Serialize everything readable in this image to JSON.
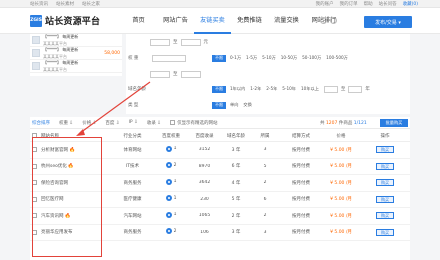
{
  "topbar": {
    "left": [
      "站长资讯",
      "站长素材",
      "站长之家"
    ],
    "right": [
      "我的账户",
      "我的订单",
      "帮助",
      "站长问答",
      "收藏(0)"
    ]
  },
  "logo": {
    "badge": "ZGIS",
    "text": "站长资源平台"
  },
  "nav": {
    "items": [
      "首页",
      "网站广告",
      "友链买卖",
      "免费推链",
      "流量交换",
      "网站排行"
    ],
    "active_index": 2
  },
  "publish_button": "发布/交易 ▾",
  "sidebar": {
    "items": [
      {
        "line1": "【*****】 每周更新",
        "line2": "某某某某平台",
        "price": ""
      },
      {
        "line1": "【*****】 每周更新",
        "line2": "某某某某平台",
        "price": "58,000"
      },
      {
        "line1": "【*****】 每周更新",
        "line2": "某某某某平台",
        "price": ""
      }
    ]
  },
  "filters": {
    "row1": {
      "unit_left": "至",
      "unit_right": "元"
    },
    "row2": {
      "label": "权 重",
      "btn": "不限",
      "options": [
        "0-1万",
        "1-5万",
        "5-10万",
        "10-50万",
        "50-100万",
        "100-500万"
      ]
    },
    "row3": {
      "unit": "至"
    },
    "row4": {
      "label": "域名年龄",
      "btn": "不限",
      "options": [
        "1年以内",
        "1-2年",
        "2-5年",
        "5-10年",
        "10年以上"
      ],
      "unit": "至",
      "unit2": "年"
    },
    "row5": {
      "label": "类 型",
      "btn": "不限",
      "options": [
        "单向",
        "交换"
      ]
    }
  },
  "tabs": {
    "items": [
      "综合排序",
      "权重 ⇩",
      "价格 ⇩",
      "百度 ⇩",
      "IP ⇩",
      "收录 ⇩"
    ],
    "active_index": 0,
    "checkbox_label": "仅显示有精选的网站"
  },
  "total": {
    "prefix": "共",
    "count": "1207",
    "suffix": "件商品",
    "page": "1/121"
  },
  "batch_button": "批量购买",
  "table": {
    "headers": [
      "网站名称",
      "行业分类",
      "百度权重",
      "百度收录",
      "域名年龄",
      "所属",
      "结算方式",
      "价格",
      "操作"
    ],
    "rows": [
      {
        "name": "分析财富官网",
        "hot": true,
        "industry": "体育网站",
        "weight": "1",
        "count": "3152",
        "age": "3 年",
        "pub": "3",
        "method": "按月付费",
        "price": "¥ 5.00 /月",
        "action": "购买"
      },
      {
        "name": "杭州seo优化",
        "hot": true,
        "industry": "IT技术",
        "weight": "2",
        "count": "8970",
        "age": "6 年",
        "pub": "5",
        "method": "按月付费",
        "price": "¥ 5.00 /月",
        "action": "购买"
      },
      {
        "name": "保险咨询官网",
        "hot": false,
        "industry": "商务服务",
        "weight": "1",
        "count": "3642",
        "age": "4 年",
        "pub": "2",
        "method": "按月付费",
        "price": "¥ 5.00 /月",
        "action": "购买"
      },
      {
        "name": "回忆医疗网",
        "hot": false,
        "industry": "医疗健康",
        "weight": "1",
        "count": "230",
        "age": "5 年",
        "pub": "6",
        "method": "按月付费",
        "price": "¥ 5.00 /月",
        "action": "购买"
      },
      {
        "name": "汽车资讯网",
        "hot": true,
        "industry": "汽车网站",
        "weight": "1",
        "count": "1065",
        "age": "2 年",
        "pub": "2",
        "method": "按月付费",
        "price": "¥ 5.00 /月",
        "action": "购买"
      },
      {
        "name": "亮丽华应用发布",
        "hot": false,
        "industry": "商务服务",
        "weight": "2",
        "count": "106",
        "age": "3 年",
        "pub": "3",
        "method": "按月付费",
        "price": "¥ 5.00 /月",
        "action": "购买"
      }
    ]
  },
  "colors": {
    "primary": "#2a7de1",
    "accent": "#ff6600",
    "annotation": "#e2433a"
  }
}
